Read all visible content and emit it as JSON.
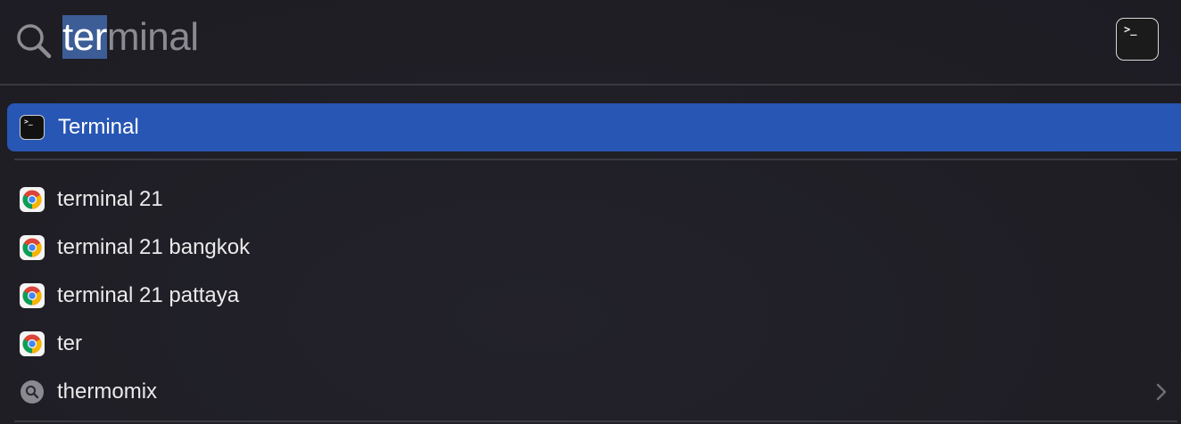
{
  "search": {
    "query_selected": "ter",
    "query_rest": "minal"
  },
  "preview": {
    "icon": "terminal-app-icon",
    "prompt_glyph": ">_"
  },
  "top_hit": {
    "label": "Terminal",
    "icon": "terminal-app-icon",
    "prompt_glyph": ">_",
    "highlight_color": "#2856b4"
  },
  "suggestions": [
    {
      "label": "terminal 21",
      "icon": "chrome-icon"
    },
    {
      "label": "terminal 21 bangkok",
      "icon": "chrome-icon"
    },
    {
      "label": "terminal 21 pattaya",
      "icon": "chrome-icon"
    },
    {
      "label": "ter",
      "icon": "chrome-icon"
    },
    {
      "label": "thermomix",
      "icon": "web-search-icon"
    }
  ],
  "colors": {
    "background": "#1f1e25",
    "selection": "#3d5d97",
    "divider": "#3a3940"
  }
}
